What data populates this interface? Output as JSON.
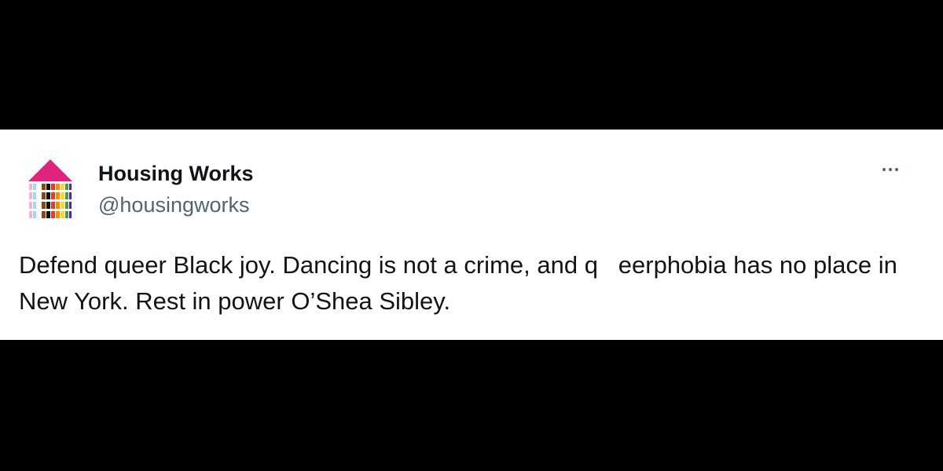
{
  "tweet": {
    "author": {
      "display_name": "Housing Works",
      "handle": "@housingworks",
      "avatar_icon": "housing-works-logo-icon"
    },
    "more_icon": "more-options-icon",
    "text": "Defend queer Black joy. Dancing is not a crime, and q   eerphobia has no place in New York. Rest in power O’Shea Sibley."
  },
  "colors": {
    "letterbox": "#000000",
    "card_background": "#ffffff",
    "primary_text": "#0f1419",
    "secondary_text": "#536471",
    "logo_roof": "#e0237f"
  }
}
